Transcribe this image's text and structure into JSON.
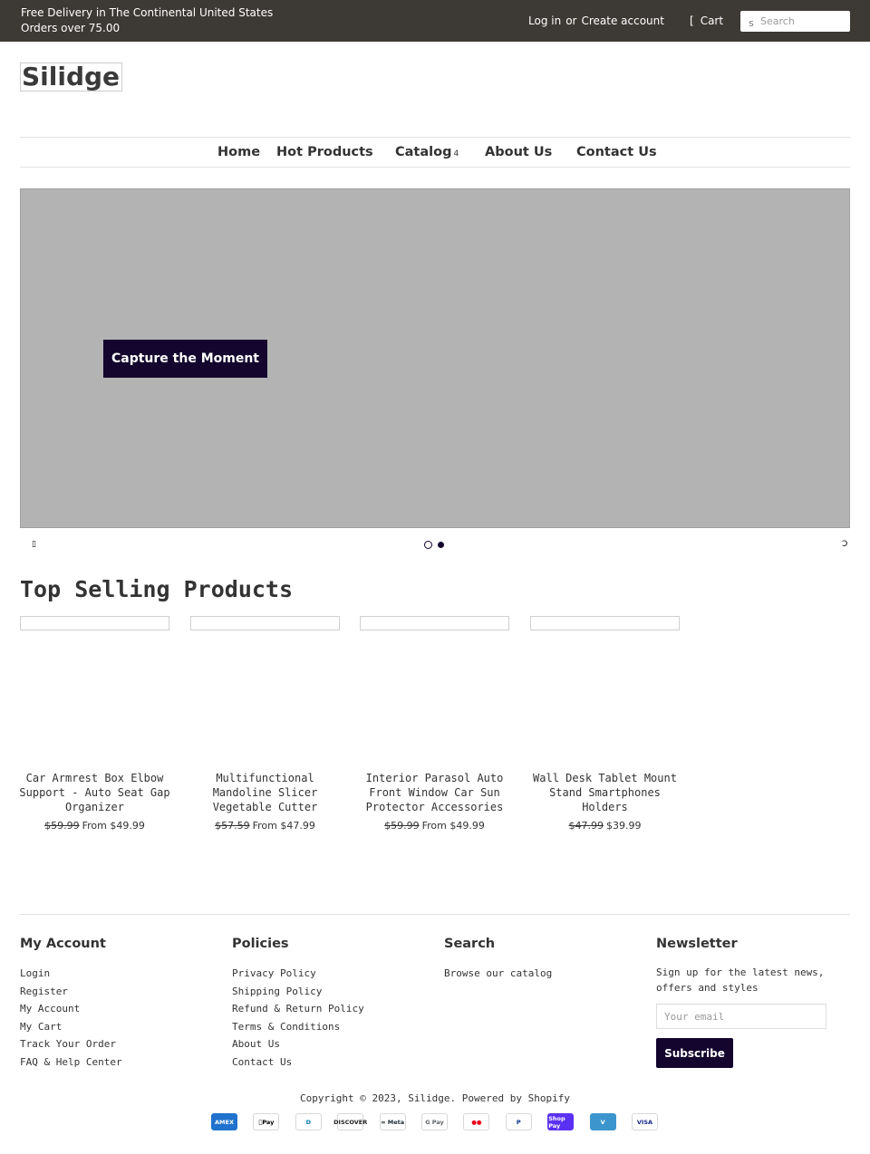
{
  "topbar": {
    "promo_line1": "Free Delivery in The Continental United States",
    "promo_line2": "Orders over 75.00",
    "login": "Log in",
    "or": "or",
    "create_account": "Create account",
    "cart_icon": "[",
    "cart": "Cart",
    "search_icon": "s",
    "search_placeholder": "Search"
  },
  "logo": "Silidge",
  "nav": {
    "items": [
      "Home",
      "Hot Products",
      "Catalog",
      "About Us",
      "Contact Us"
    ],
    "catalog_caret": "4"
  },
  "slideshow": {
    "cta": "Capture the Moment",
    "prev_icon": "▯",
    "next_icon": "Ↄ"
  },
  "section_title": "Top Selling Products",
  "products": [
    {
      "title": "Car Armrest Box Elbow Support - Auto Seat Gap Organizer",
      "old_price": "$59.99",
      "price": "From $49.99"
    },
    {
      "title": "Multifunctional Mandoline Slicer Vegetable Cutter",
      "old_price": "$57.59",
      "price": "From $47.99"
    },
    {
      "title": "Interior Parasol Auto Front Window Car Sun Protector Accessories",
      "old_price": "$59.99",
      "price": "From $49.99"
    },
    {
      "title": "Wall Desk Tablet Mount Stand Smartphones Holders",
      "old_price": "$47.99",
      "price": "$39.99"
    }
  ],
  "footer": {
    "my_account": {
      "heading": "My Account",
      "links": [
        "Login",
        "Register",
        "My Account",
        "My Cart",
        "Track Your Order",
        "FAQ & Help Center"
      ]
    },
    "policies": {
      "heading": "Policies",
      "links": [
        "Privacy Policy",
        "Shipping Policy",
        "Refund & Return Policy",
        "Terms & Conditions",
        "About Us",
        "Contact Us"
      ]
    },
    "search": {
      "heading": "Search",
      "links": [
        "Browse our catalog"
      ]
    },
    "newsletter": {
      "heading": "Newsletter",
      "text": "Sign up for the latest news, offers and styles",
      "placeholder": "Your email",
      "button": "Subscribe"
    },
    "copyright": "Copyright © 2023, Silidge. Powered by Shopify",
    "payments": [
      {
        "name": "amex-icon",
        "label": "AMEX",
        "bg": "#1f72cd",
        "fg": "#ffffff"
      },
      {
        "name": "apple-pay-icon",
        "label": "Pay",
        "bg": "#ffffff",
        "fg": "#000000"
      },
      {
        "name": "diners-club-icon",
        "label": "D",
        "bg": "#ffffff",
        "fg": "#0079be"
      },
      {
        "name": "discover-icon",
        "label": "DISCOVER",
        "bg": "#ffffff",
        "fg": "#231f20"
      },
      {
        "name": "meta-pay-icon",
        "label": "∞ Meta",
        "bg": "#ffffff",
        "fg": "#1c2b33"
      },
      {
        "name": "google-pay-icon",
        "label": "G Pay",
        "bg": "#ffffff",
        "fg": "#5f6368"
      },
      {
        "name": "mastercard-icon",
        "label": "●●",
        "bg": "#ffffff",
        "fg": "#eb001b"
      },
      {
        "name": "paypal-icon",
        "label": "P",
        "bg": "#ffffff",
        "fg": "#003087"
      },
      {
        "name": "shop-pay-icon",
        "label": "Shop Pay",
        "bg": "#5a31f4",
        "fg": "#ffffff"
      },
      {
        "name": "venmo-icon",
        "label": "V",
        "bg": "#3d95ce",
        "fg": "#ffffff"
      },
      {
        "name": "visa-icon",
        "label": "VISA",
        "bg": "#ffffff",
        "fg": "#142688"
      }
    ]
  },
  "colors": {
    "topbar_bg": "#3d3935",
    "accent": "#14052e",
    "slide_bg": "#b3b3b3"
  }
}
